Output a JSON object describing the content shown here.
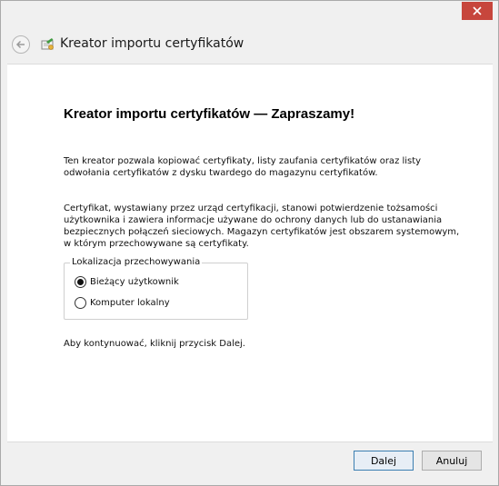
{
  "window": {
    "close_icon": "close-icon",
    "close_color": "#c7463c"
  },
  "header": {
    "back_icon": "back-arrow-icon",
    "app_icon": "certificate-icon",
    "title": "Kreator importu certyfikatów"
  },
  "main": {
    "heading": "Kreator importu certyfikatów — Zapraszamy!",
    "paragraph_1": "Ten kreator pozwala kopiować certyfikaty, listy zaufania certyfikatów oraz listy odwołania certyfikatów z dysku twardego do magazynu certyfikatów.",
    "paragraph_2": "Certyfikat, wystawiany przez urząd certyfikacji, stanowi potwierdzenie tożsamości użytkownika i zawiera informacje używane do ochrony danych lub do ustanawiania bezpiecznych połączeń sieciowych. Magazyn certyfikatów jest obszarem systemowym, w którym przechowywane są certyfikaty.",
    "storage_group": {
      "legend": "Lokalizacja przechowywania",
      "options": [
        {
          "label": "Bieżący użytkownik",
          "selected": true
        },
        {
          "label": "Komputer lokalny",
          "selected": false
        }
      ]
    },
    "footer_text": "Aby kontynuować, kliknij przycisk Dalej."
  },
  "buttons": {
    "next_label": "Dalej",
    "cancel_label": "Anuluj"
  }
}
